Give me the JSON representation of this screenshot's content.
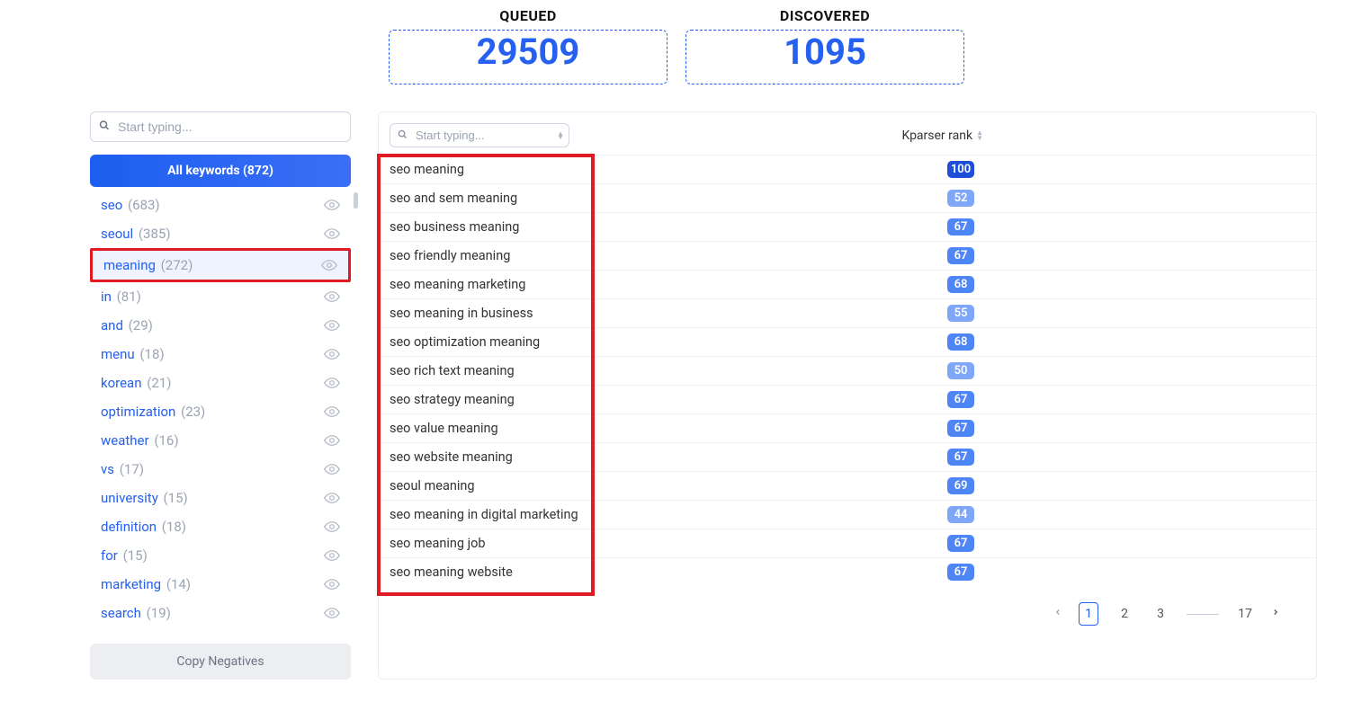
{
  "stats": {
    "queued": {
      "label": "QUEUED",
      "value": "29509"
    },
    "discovered": {
      "label": "DISCOVERED",
      "value": "1095"
    }
  },
  "sidebar": {
    "search_placeholder": "Start typing...",
    "all_label": "All keywords (872)",
    "copy_negatives": "Copy Negatives",
    "items": [
      {
        "name": "seo",
        "count": "(683)",
        "active": false
      },
      {
        "name": "seoul",
        "count": "(385)",
        "active": false
      },
      {
        "name": "meaning",
        "count": "(272)",
        "active": true
      },
      {
        "name": "in",
        "count": "(81)",
        "active": false
      },
      {
        "name": "and",
        "count": "(29)",
        "active": false
      },
      {
        "name": "menu",
        "count": "(18)",
        "active": false
      },
      {
        "name": "korean",
        "count": "(21)",
        "active": false
      },
      {
        "name": "optimization",
        "count": "(23)",
        "active": false
      },
      {
        "name": "weather",
        "count": "(16)",
        "active": false
      },
      {
        "name": "vs",
        "count": "(17)",
        "active": false
      },
      {
        "name": "university",
        "count": "(15)",
        "active": false
      },
      {
        "name": "definition",
        "count": "(18)",
        "active": false
      },
      {
        "name": "for",
        "count": "(15)",
        "active": false
      },
      {
        "name": "marketing",
        "count": "(14)",
        "active": false
      },
      {
        "name": "search",
        "count": "(19)",
        "active": false
      }
    ]
  },
  "table": {
    "search_placeholder": "Start typing...",
    "rank_header": "Kparser rank",
    "rows": [
      {
        "text": "seo meaning",
        "rank": "100",
        "style": "dark"
      },
      {
        "text": "seo and sem meaning",
        "rank": "52",
        "style": "light"
      },
      {
        "text": "seo business meaning",
        "rank": "67",
        "style": "mid"
      },
      {
        "text": "seo friendly meaning",
        "rank": "67",
        "style": "mid"
      },
      {
        "text": "seo meaning marketing",
        "rank": "68",
        "style": "mid"
      },
      {
        "text": "seo meaning in business",
        "rank": "55",
        "style": "light"
      },
      {
        "text": "seo optimization meaning",
        "rank": "68",
        "style": "mid"
      },
      {
        "text": "seo rich text meaning",
        "rank": "50",
        "style": "light"
      },
      {
        "text": "seo strategy meaning",
        "rank": "67",
        "style": "mid"
      },
      {
        "text": "seo value meaning",
        "rank": "67",
        "style": "mid"
      },
      {
        "text": "seo website meaning",
        "rank": "67",
        "style": "mid"
      },
      {
        "text": "seoul meaning",
        "rank": "69",
        "style": "mid"
      },
      {
        "text": "seo meaning in digital marketing",
        "rank": "44",
        "style": "light"
      },
      {
        "text": "seo meaning job",
        "rank": "67",
        "style": "mid"
      },
      {
        "text": "seo meaning website",
        "rank": "67",
        "style": "mid"
      }
    ]
  },
  "pagination": {
    "pages": [
      "1",
      "2",
      "3"
    ],
    "last": "17",
    "active": "1"
  }
}
